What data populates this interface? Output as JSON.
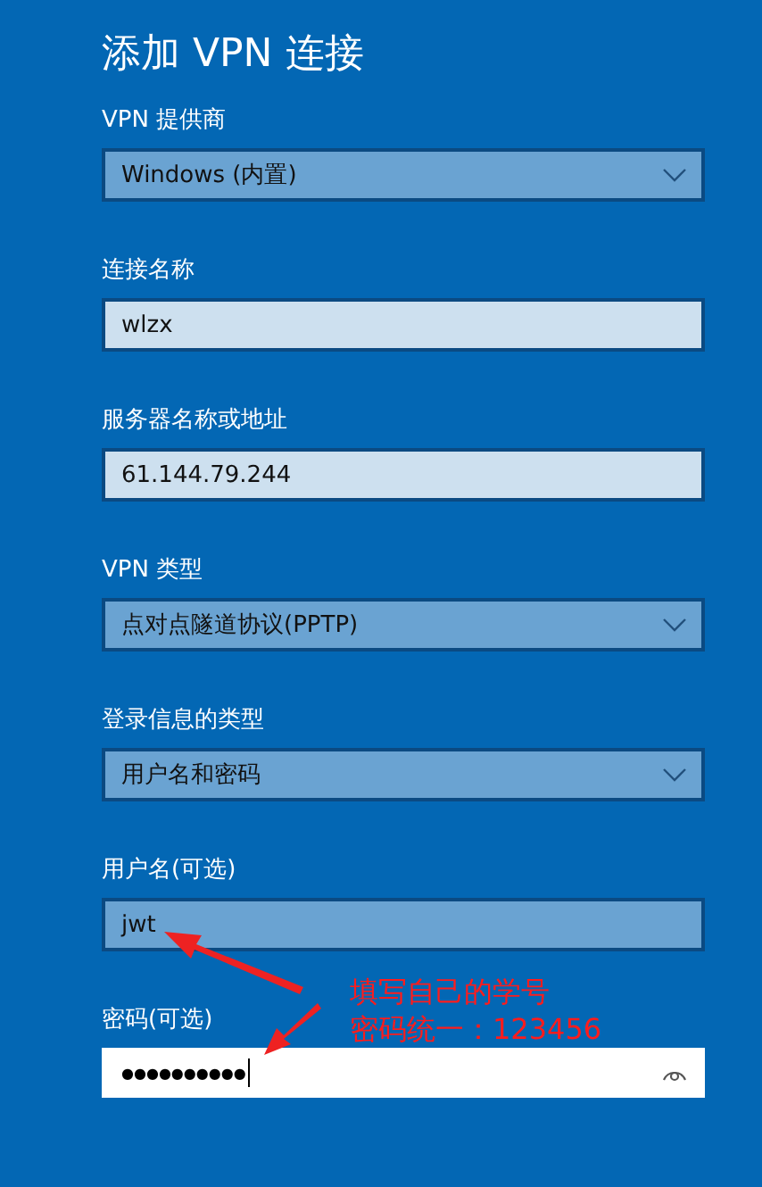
{
  "title": "添加 VPN 连接",
  "fields": [
    {
      "label": "VPN 提供商",
      "kind": "dropdown",
      "value": "Windows (内置)"
    },
    {
      "label": "连接名称",
      "kind": "textbox",
      "value": "wlzx"
    },
    {
      "label": "服务器名称或地址",
      "kind": "textbox",
      "value": "61.144.79.244"
    },
    {
      "label": "VPN 类型",
      "kind": "dropdown",
      "value": "点对点隧道协议(PPTP)"
    },
    {
      "label": "登录信息的类型",
      "kind": "dropdown",
      "value": "用户名和密码"
    },
    {
      "label": "用户名(可选)",
      "kind": "flat",
      "value": "jwt"
    },
    {
      "label": "密码(可选)",
      "kind": "password",
      "value": "●●●●●●●●●●"
    }
  ],
  "annotation": {
    "lines": [
      "填写自己的学号",
      "密码统一：123456"
    ]
  }
}
